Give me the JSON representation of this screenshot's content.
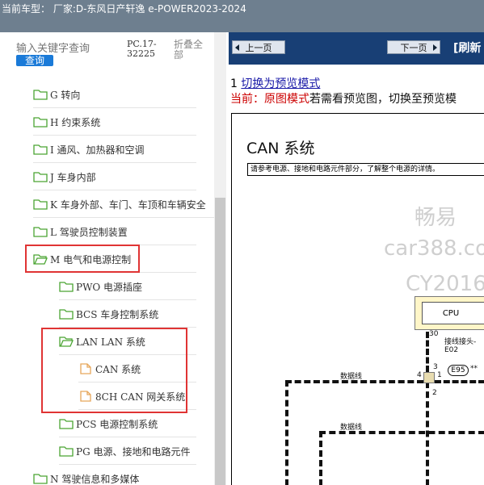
{
  "header": {
    "title": "当前车型： 厂家:D-东风日产轩逸 e-POWER2023-2024"
  },
  "sidebar": {
    "search_placeholder": "输入关键字查询",
    "search_button": "查询",
    "version": "PC.17-32225",
    "collapse_all": "折叠全部",
    "items": [
      {
        "label": "G 转向",
        "type": "folder"
      },
      {
        "label": "H 约束系统",
        "type": "folder"
      },
      {
        "label": "I 通风、加热器和空调",
        "type": "folder"
      },
      {
        "label": "J 车身内部",
        "type": "folder"
      },
      {
        "label": "K 车身外部、车门、车顶和车辆安全",
        "type": "folder"
      },
      {
        "label": "L 驾驶员控制装置",
        "type": "folder"
      },
      {
        "label": "M 电气和电源控制",
        "type": "folder-open"
      },
      {
        "label": "PWO 电源插座",
        "type": "folder"
      },
      {
        "label": "BCS 车身控制系统",
        "type": "folder"
      },
      {
        "label": "LAN LAN 系统",
        "type": "folder-open"
      },
      {
        "label": "CAN 系统",
        "type": "file"
      },
      {
        "label": "8CH CAN 网关系统",
        "type": "file"
      },
      {
        "label": "PCS 电源控制系统",
        "type": "folder"
      },
      {
        "label": "PG 电源、接地和电路元件",
        "type": "folder"
      },
      {
        "label": "N 驾驶信息和多媒体",
        "type": "folder"
      }
    ]
  },
  "toolbar": {
    "prev": "上一页",
    "next": "下一页",
    "refresh": "[刷新"
  },
  "content": {
    "line1_num": "1",
    "line1_link": "切换为预览模式",
    "line2_prefix": "当前：原图模式",
    "line2_rest": "若需看预览图，切换至预览模",
    "doc_title": "CAN 系统",
    "doc_note": "请参考电源、接地和电路元件部分，了解整个电源的详情。",
    "watermark": [
      "畅易",
      "car388.co",
      "CY2016"
    ],
    "cpu_label": "CPU",
    "pin_30": "30",
    "connector_label": "接线接头-E02",
    "connector_code": "E95",
    "stars": "**",
    "pin_3": "3",
    "pin_4": "4",
    "pin_1": "1",
    "pin_2": "2",
    "wire_label_1": "数据线",
    "wire_label_2": "数据线"
  },
  "colors": {
    "accent": "#1a7ad8",
    "nav": "#183f75",
    "highlight": "#e03434",
    "folder": "#4aa532",
    "file": "#e6a65a"
  }
}
